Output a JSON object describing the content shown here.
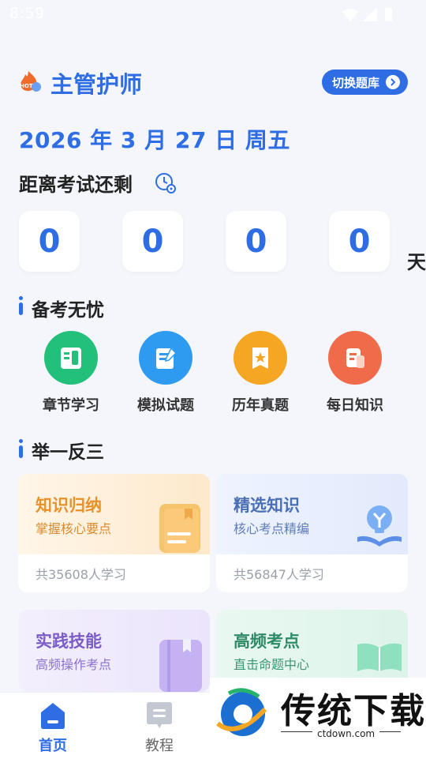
{
  "status_bar": {
    "time": "8:59"
  },
  "header": {
    "title": "主管护师",
    "switch_label": "切换题库"
  },
  "date": "2026 年 3 月 27 日 周五",
  "countdown": {
    "label": "距离考试还剩",
    "digits": [
      "0",
      "0",
      "0",
      "0"
    ],
    "unit": "天"
  },
  "prep_section": {
    "title": "备考无忧",
    "items": [
      {
        "label": "章节学习",
        "color": "#22c07a"
      },
      {
        "label": "模拟试题",
        "color": "#2e9bf0"
      },
      {
        "label": "历年真题",
        "color": "#f5a623"
      },
      {
        "label": "每日知识",
        "color": "#ef6b4a"
      }
    ]
  },
  "practice_section": {
    "title": "举一反三",
    "cards": [
      {
        "title": "知识归纳",
        "subtitle": "掌握核心要点",
        "footer": "共35608人学习",
        "accent": "#e6922b",
        "bg": "#fff4e4"
      },
      {
        "title": "精选知识",
        "subtitle": "核心考点精编",
        "footer": "共56847人学习",
        "accent": "#4a6fb5",
        "bg": "#eaf0fd"
      },
      {
        "title": "实践技能",
        "subtitle": "高频操作考点",
        "footer": "",
        "accent": "#7a5cc9",
        "bg": "#f1edfc"
      },
      {
        "title": "高频考点",
        "subtitle": "直击命题中心",
        "footer": "",
        "accent": "#2f8a67",
        "bg": "#e6f7f0"
      }
    ]
  },
  "tabbar": {
    "tabs": [
      {
        "label": "首页"
      },
      {
        "label": "教程"
      }
    ]
  },
  "watermark": {
    "name": "传统下载",
    "site": "ctdown.com"
  },
  "colors": {
    "primary": "#2f6de5",
    "background": "#f4f6fb"
  }
}
